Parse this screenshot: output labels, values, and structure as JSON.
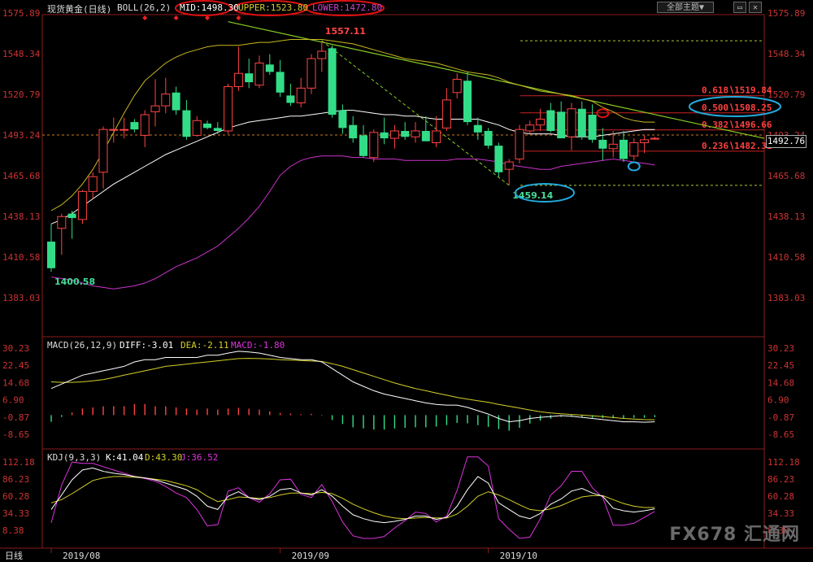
{
  "header": {
    "title": "现货黄金(日线)",
    "boll_params": "BOLL(26,2)",
    "mid": "MID:1498.30",
    "upper": "UPPER:1523.80",
    "lower": "LOWER:1472.80",
    "theme_button": "全部主题▼"
  },
  "macd_header": {
    "params": "MACD(26,12,9)",
    "diff": "DIFF:-3.01",
    "dea": "DEA:-2.11",
    "macd": "MACD:-1.80"
  },
  "kdj_header": {
    "params": "KDJ(9,3,3)",
    "k": "K:41.04",
    "d": "D:43.30",
    "j": "J:36.52"
  },
  "watermark": "FX678 汇通网",
  "current_price": "1492.76",
  "colors": {
    "up": "#ff4444",
    "down": "#33dd88",
    "mid": "#ffffff",
    "upper": "#c8b820",
    "lower": "#cc33cc",
    "diff": "#ffffff",
    "dea": "#d4d02a",
    "k": "#ffffff",
    "d": "#d4d02a",
    "j": "#dd33dd"
  },
  "chart_data": [
    {
      "type": "candlestick",
      "title": "现货黄金(日线) BOLL(26,2)",
      "price_ticks": [
        "1575.89",
        "1548.34",
        "1520.79",
        "1493.24",
        "1465.68",
        "1438.13",
        "1410.58",
        "1383.03"
      ],
      "ylim": [
        1383.03,
        1575.89
      ],
      "date_labels": [
        {
          "i": 0,
          "label": "2019/08"
        },
        {
          "i": 22,
          "label": "2019/09"
        },
        {
          "i": 42,
          "label": "2019/10"
        }
      ],
      "candles": [
        {
          "o": 1421,
          "h": 1433,
          "l": 1400.58,
          "c": 1403
        },
        {
          "o": 1430,
          "h": 1440,
          "l": 1412,
          "c": 1438
        },
        {
          "o": 1440,
          "h": 1442,
          "l": 1423,
          "c": 1437
        },
        {
          "o": 1436,
          "h": 1456,
          "l": 1433,
          "c": 1455
        },
        {
          "o": 1455,
          "h": 1468,
          "l": 1450,
          "c": 1465
        },
        {
          "o": 1468,
          "h": 1499,
          "l": 1457,
          "c": 1497
        },
        {
          "o": 1497,
          "h": 1505,
          "l": 1488,
          "c": 1497
        },
        {
          "o": 1497,
          "h": 1505,
          "l": 1491,
          "c": 1497
        },
        {
          "o": 1502,
          "h": 1504,
          "l": 1495,
          "c": 1497
        },
        {
          "o": 1493,
          "h": 1510,
          "l": 1485,
          "c": 1507
        },
        {
          "o": 1509,
          "h": 1531,
          "l": 1499,
          "c": 1513
        },
        {
          "o": 1513,
          "h": 1532,
          "l": 1508,
          "c": 1521
        },
        {
          "o": 1522,
          "h": 1526,
          "l": 1507,
          "c": 1510
        },
        {
          "o": 1510,
          "h": 1517,
          "l": 1490,
          "c": 1492
        },
        {
          "o": 1493,
          "h": 1506,
          "l": 1492,
          "c": 1503
        },
        {
          "o": 1501,
          "h": 1503,
          "l": 1497,
          "c": 1498
        },
        {
          "o": 1498,
          "h": 1502,
          "l": 1494,
          "c": 1496
        },
        {
          "o": 1496,
          "h": 1528,
          "l": 1494,
          "c": 1526
        },
        {
          "o": 1526,
          "h": 1553,
          "l": 1523,
          "c": 1535
        },
        {
          "o": 1535,
          "h": 1545,
          "l": 1525,
          "c": 1529
        },
        {
          "o": 1527,
          "h": 1547,
          "l": 1525,
          "c": 1542
        },
        {
          "o": 1541,
          "h": 1548,
          "l": 1534,
          "c": 1536
        },
        {
          "o": 1536,
          "h": 1544,
          "l": 1519,
          "c": 1522
        },
        {
          "o": 1520,
          "h": 1528,
          "l": 1513,
          "c": 1515
        },
        {
          "o": 1515,
          "h": 1532,
          "l": 1512,
          "c": 1525
        },
        {
          "o": 1525,
          "h": 1548,
          "l": 1521,
          "c": 1545
        },
        {
          "o": 1545,
          "h": 1557.11,
          "l": 1536,
          "c": 1550
        },
        {
          "o": 1552,
          "h": 1554,
          "l": 1505,
          "c": 1507
        },
        {
          "o": 1510,
          "h": 1514,
          "l": 1494,
          "c": 1498
        },
        {
          "o": 1500,
          "h": 1506,
          "l": 1488,
          "c": 1491
        },
        {
          "o": 1493,
          "h": 1500,
          "l": 1478,
          "c": 1479
        },
        {
          "o": 1478,
          "h": 1497,
          "l": 1475,
          "c": 1495
        },
        {
          "o": 1495,
          "h": 1505,
          "l": 1487,
          "c": 1491
        },
        {
          "o": 1491,
          "h": 1500,
          "l": 1484,
          "c": 1496
        },
        {
          "o": 1496,
          "h": 1502,
          "l": 1490,
          "c": 1492
        },
        {
          "o": 1492,
          "h": 1502,
          "l": 1488,
          "c": 1496
        },
        {
          "o": 1496,
          "h": 1506,
          "l": 1490,
          "c": 1489
        },
        {
          "o": 1488,
          "h": 1506,
          "l": 1485,
          "c": 1496
        },
        {
          "o": 1498,
          "h": 1525,
          "l": 1496,
          "c": 1517
        },
        {
          "o": 1522,
          "h": 1535,
          "l": 1518,
          "c": 1531
        },
        {
          "o": 1530,
          "h": 1536,
          "l": 1500,
          "c": 1502
        },
        {
          "o": 1500,
          "h": 1505,
          "l": 1490,
          "c": 1495
        },
        {
          "o": 1496,
          "h": 1498,
          "l": 1484,
          "c": 1486
        },
        {
          "o": 1486,
          "h": 1488,
          "l": 1465,
          "c": 1468
        },
        {
          "o": 1470,
          "h": 1477,
          "l": 1459.14,
          "c": 1475
        },
        {
          "o": 1477,
          "h": 1500,
          "l": 1474,
          "c": 1497
        },
        {
          "o": 1496,
          "h": 1503,
          "l": 1494,
          "c": 1500
        },
        {
          "o": 1500,
          "h": 1511,
          "l": 1496,
          "c": 1504
        },
        {
          "o": 1510,
          "h": 1515,
          "l": 1495,
          "c": 1496
        },
        {
          "o": 1509,
          "h": 1516,
          "l": 1500,
          "c": 1491
        },
        {
          "o": 1492,
          "h": 1515,
          "l": 1483,
          "c": 1511
        },
        {
          "o": 1511,
          "h": 1516,
          "l": 1490,
          "c": 1492
        },
        {
          "o": 1507,
          "h": 1514,
          "l": 1488,
          "c": 1490
        },
        {
          "o": 1490,
          "h": 1498,
          "l": 1476,
          "c": 1484
        },
        {
          "o": 1484,
          "h": 1496,
          "l": 1478,
          "c": 1487
        },
        {
          "o": 1490,
          "h": 1496,
          "l": 1475,
          "c": 1477
        },
        {
          "o": 1479,
          "h": 1491,
          "l": 1476,
          "c": 1488
        },
        {
          "o": 1488,
          "h": 1493,
          "l": 1481,
          "c": 1490
        },
        {
          "o": 1491,
          "h": 1492,
          "l": 1490,
          "c": 1491
        }
      ],
      "boll_mid": [
        1433,
        1436,
        1440,
        1445,
        1450,
        1455,
        1460,
        1464,
        1468,
        1472,
        1476,
        1480,
        1483,
        1486,
        1489,
        1492,
        1495,
        1498,
        1500,
        1502,
        1503,
        1504,
        1505,
        1506,
        1506,
        1507,
        1508,
        1509,
        1510,
        1510,
        1509,
        1508,
        1507,
        1507,
        1506,
        1506,
        1505,
        1504,
        1504,
        1504,
        1504,
        1504,
        1502,
        1500,
        1497,
        1495,
        1494,
        1494,
        1494,
        1493,
        1492,
        1492,
        1492,
        1493,
        1494,
        1495,
        1496,
        1497,
        1497
      ],
      "boll_upper": [
        1442,
        1446,
        1452,
        1460,
        1470,
        1482,
        1495,
        1508,
        1520,
        1530,
        1536,
        1542,
        1546,
        1549,
        1551,
        1553,
        1554,
        1554,
        1554,
        1555,
        1556,
        1556,
        1557,
        1558,
        1558,
        1558,
        1558,
        1557,
        1556,
        1555,
        1553,
        1551,
        1549,
        1547,
        1545,
        1544,
        1543,
        1542,
        1540,
        1538,
        1536,
        1535,
        1534,
        1532,
        1529,
        1527,
        1525,
        1523,
        1522,
        1521,
        1520,
        1518,
        1516,
        1512,
        1509,
        1505,
        1503,
        1502,
        1502
      ],
      "boll_lower": [
        1397,
        1396,
        1395,
        1393,
        1391,
        1390,
        1389,
        1390,
        1391,
        1393,
        1396,
        1400,
        1404,
        1407,
        1410,
        1414,
        1418,
        1424,
        1430,
        1437,
        1445,
        1455,
        1466,
        1472,
        1476,
        1478,
        1479,
        1479,
        1479,
        1478,
        1478,
        1477,
        1477,
        1477,
        1476,
        1476,
        1476,
        1476,
        1476,
        1477,
        1477,
        1477,
        1476,
        1475,
        1473,
        1472,
        1471,
        1470,
        1470,
        1472,
        1473,
        1474,
        1475,
        1476,
        1477,
        1476,
        1475,
        1474,
        1473
      ],
      "annotations": [
        {
          "label": "1557.11",
          "i": 26,
          "price": 1557.11
        },
        {
          "label": "1400.58",
          "i": 0,
          "price": 1400.58
        },
        {
          "label": "1459.14",
          "i": 44,
          "price": 1459.14
        }
      ],
      "fib_levels": [
        {
          "label": "0.618∖1519.84",
          "price": 1519.84
        },
        {
          "label": "0.500∖1508.25",
          "price": 1508.25
        },
        {
          "label": "0.382∖1496.66",
          "price": 1496.66
        },
        {
          "label": "0.236∖1482.31",
          "price": 1482.31
        }
      ],
      "ref_levels": [
        1557.11,
        1459.14
      ],
      "last_price_line": 1493.24
    },
    {
      "type": "macd",
      "title": "MACD(26,12,9)",
      "ticks": [
        "30.23",
        "22.45",
        "14.68",
        "6.90",
        "-0.87",
        "-8.65"
      ],
      "ylim": [
        -8.65,
        30.23
      ],
      "diff": [
        12,
        14,
        16,
        18,
        19,
        20,
        21,
        22,
        24,
        25,
        25,
        26,
        26,
        26,
        26,
        27,
        27,
        28,
        28.8,
        28.5,
        28,
        27,
        26,
        25.5,
        25,
        25,
        24,
        21,
        18,
        15,
        13,
        11,
        9.5,
        8.5,
        7.5,
        6.5,
        5.5,
        4.8,
        4.5,
        4.5,
        3.5,
        2,
        0.5,
        -1.5,
        -3,
        -2.5,
        -1.5,
        -1,
        -0.6,
        -0.2,
        -0.5,
        -1,
        -1.5,
        -2,
        -2.5,
        -3,
        -3,
        -3.2,
        -3
      ],
      "dea": [
        15,
        14.8,
        14.8,
        15,
        15.5,
        16,
        17,
        18,
        19,
        20,
        21,
        22,
        22.5,
        23,
        23.5,
        24,
        24.5,
        25,
        25.5,
        25.6,
        25.5,
        25.3,
        25,
        24.8,
        24.6,
        24.4,
        24.2,
        23.2,
        22,
        20.5,
        19,
        17.5,
        16,
        14.5,
        13.2,
        12,
        11,
        10,
        9,
        8,
        7.2,
        6.5,
        5.8,
        4.8,
        4,
        3.2,
        2.3,
        1.5,
        1,
        0.6,
        0.3,
        0,
        -0.3,
        -0.7,
        -1.1,
        -1.5,
        -1.8,
        -2,
        -2.1
      ],
      "macd": [
        -3,
        -0.8,
        1.2,
        3,
        3.5,
        4,
        4,
        4,
        5,
        5,
        4,
        4,
        3.5,
        3,
        2.5,
        3,
        2.5,
        3,
        3.3,
        2.9,
        2.5,
        1.7,
        1,
        0.7,
        0.4,
        0.6,
        -0.2,
        -2.2,
        -4,
        -5.5,
        -6,
        -6.5,
        -6.5,
        -6,
        -5.7,
        -5.5,
        -5.5,
        -5.2,
        -4.5,
        -3.5,
        -3.7,
        -4.5,
        -5.3,
        -6.3,
        -7,
        -5.7,
        -3.8,
        -2.5,
        -1.6,
        -0.8,
        -0.8,
        -1,
        -1.2,
        -1.3,
        -1.4,
        -1.5,
        -1.2,
        -1.2,
        -0.9
      ]
    },
    {
      "type": "kdj",
      "title": "KDJ(9,3,3)",
      "ticks": [
        "112.18",
        "86.23",
        "60.28",
        "34.33",
        "8.38"
      ],
      "ylim": [
        8.38,
        112.18
      ],
      "k": [
        40,
        62,
        85,
        100,
        103,
        98,
        95,
        93,
        90,
        88,
        85,
        80,
        75,
        70,
        60,
        45,
        40,
        60,
        67,
        58,
        55,
        60,
        70,
        72,
        65,
        62,
        70,
        60,
        45,
        32,
        26,
        22,
        20,
        22,
        25,
        30,
        30,
        25,
        28,
        45,
        70,
        90,
        80,
        50,
        40,
        30,
        26,
        34,
        48,
        56,
        68,
        72,
        65,
        60,
        42,
        38,
        36,
        38,
        41
      ],
      "d": [
        50,
        55,
        64,
        74,
        84,
        88,
        90,
        90,
        89,
        88,
        86,
        84,
        80,
        76,
        70,
        60,
        52,
        55,
        59,
        58,
        57,
        58,
        62,
        65,
        65,
        64,
        66,
        64,
        57,
        48,
        41,
        35,
        30,
        27,
        26,
        27,
        28,
        27,
        27,
        33,
        45,
        60,
        67,
        62,
        55,
        47,
        40,
        38,
        41,
        46,
        53,
        59,
        61,
        61,
        55,
        49,
        45,
        43,
        43
      ],
      "j": [
        20,
        77,
        112,
        110,
        110,
        105,
        100,
        95,
        90,
        87,
        83,
        75,
        65,
        58,
        40,
        15,
        17,
        68,
        73,
        58,
        51,
        64,
        85,
        86,
        63,
        58,
        78,
        52,
        21,
        0,
        -4,
        -4,
        -1,
        12,
        23,
        36,
        34,
        21,
        30,
        69,
        120,
        120,
        106,
        26,
        10,
        -4,
        -2,
        26,
        62,
        76,
        98,
        98,
        73,
        58,
        16,
        16,
        19,
        28,
        37
      ]
    }
  ]
}
